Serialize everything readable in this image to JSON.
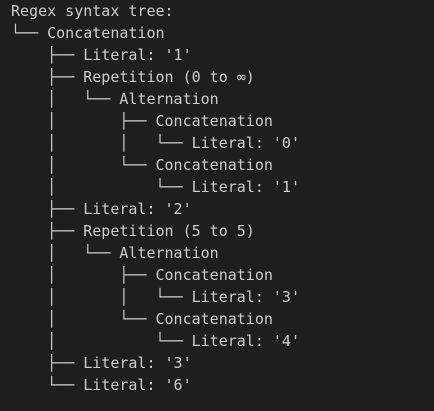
{
  "terminal": {
    "lines": [
      {
        "prefix": "",
        "text": "Regex syntax tree:"
      },
      {
        "prefix": "└── ",
        "text": "Concatenation"
      },
      {
        "prefix": "    ├── ",
        "text": "Literal: '1'"
      },
      {
        "prefix": "    ├── ",
        "text": "Repetition (0 to ∞)"
      },
      {
        "prefix": "    │   └── ",
        "text": "Alternation"
      },
      {
        "prefix": "    │       ├── ",
        "text": "Concatenation"
      },
      {
        "prefix": "    │       │   └── ",
        "text": "Literal: '0'"
      },
      {
        "prefix": "    │       └── ",
        "text": "Concatenation"
      },
      {
        "prefix": "    │           └── ",
        "text": "Literal: '1'"
      },
      {
        "prefix": "    ├── ",
        "text": "Literal: '2'"
      },
      {
        "prefix": "    ├── ",
        "text": "Repetition (5 to 5)"
      },
      {
        "prefix": "    │   └── ",
        "text": "Alternation"
      },
      {
        "prefix": "    │       ├── ",
        "text": "Concatenation"
      },
      {
        "prefix": "    │       │   └── ",
        "text": "Literal: '3'"
      },
      {
        "prefix": "    │       └── ",
        "text": "Concatenation"
      },
      {
        "prefix": "    │           └── ",
        "text": "Literal: '4'"
      },
      {
        "prefix": "    ├── ",
        "text": "Literal: '3'"
      },
      {
        "prefix": "    └── ",
        "text": "Literal: '6'"
      }
    ]
  }
}
